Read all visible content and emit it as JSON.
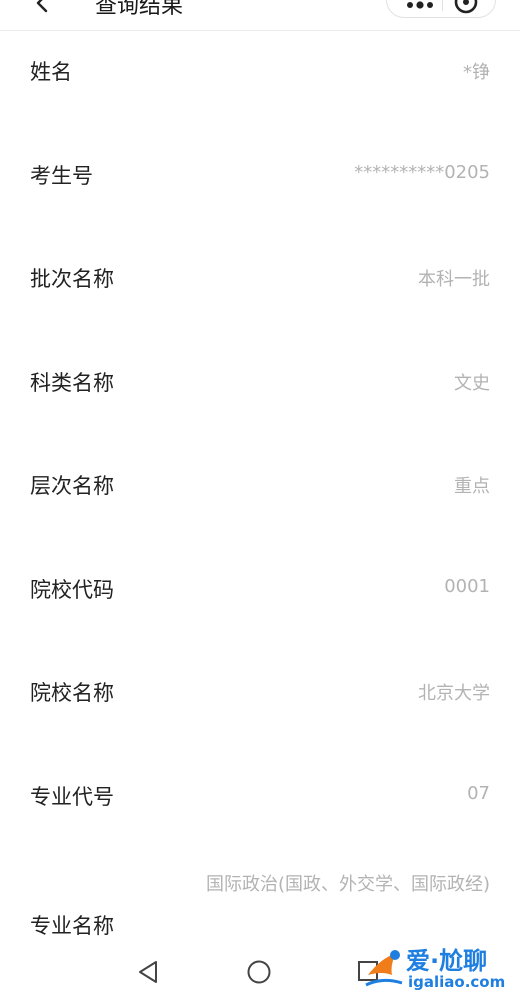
{
  "header": {
    "title": "查询结果"
  },
  "rows": [
    {
      "label": "姓名",
      "value": "*铮"
    },
    {
      "label": "考生号",
      "value": "**********0205"
    },
    {
      "label": "批次名称",
      "value": "本科一批"
    },
    {
      "label": "科类名称",
      "value": "文史"
    },
    {
      "label": "层次名称",
      "value": "重点"
    },
    {
      "label": "院校代码",
      "value": "0001"
    },
    {
      "label": "院校名称",
      "value": "北京大学"
    },
    {
      "label": "专业代号",
      "value": "07"
    },
    {
      "label": "专业名称",
      "value": "国际政治(国政、外交学、国际政经)"
    }
  ],
  "watermark": {
    "brand": "爱·尬聊",
    "url": "igaliao.com"
  },
  "colors": {
    "label": "#222222",
    "value": "#b3b3b3",
    "watermark": "#1f7fe0"
  }
}
